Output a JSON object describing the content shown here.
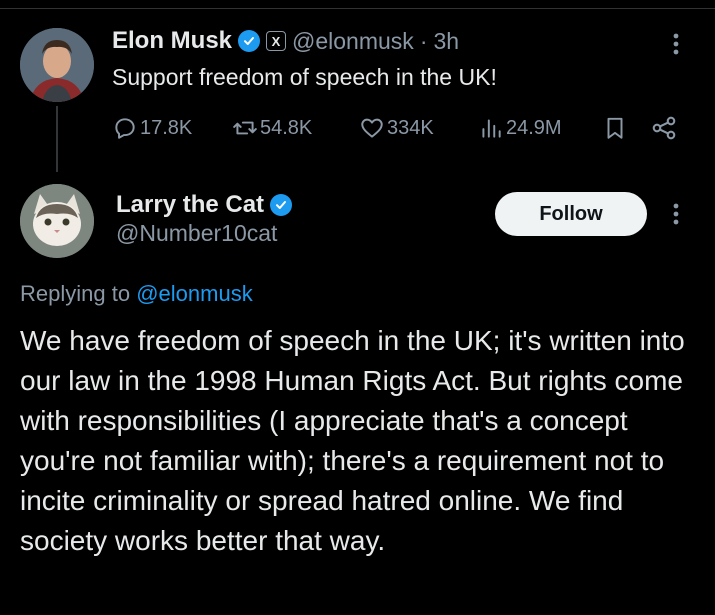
{
  "parent_tweet": {
    "display_name": "Elon Musk",
    "handle": "@elonmusk",
    "separator": "·",
    "time": "3h",
    "text": "Support freedom of speech in the UK!",
    "affiliate_badge": "X",
    "avatar_icon": "elon-musk-avatar",
    "stats": {
      "replies": "17.8K",
      "reposts": "54.8K",
      "likes": "334K",
      "views": "24.9M"
    }
  },
  "reply_tweet": {
    "display_name": "Larry the Cat",
    "handle": "@Number10cat",
    "follow_label": "Follow",
    "replying_prefix": "Replying to",
    "replying_handle": "@elonmusk",
    "text": "We have freedom of speech in the UK; it's written into our law in the 1998 Human Rigts Act. But rights come with responsibilities (I appreciate that's a concept you're not familiar with); there's a requirement not to incite criminality or spread hatred online. We find society works better that way.",
    "avatar_icon": "cat-avatar"
  },
  "colors": {
    "background": "#000000",
    "text_primary": "#e7e9ea",
    "text_secondary": "#8b98a5",
    "accent_blue": "#1d9bf0",
    "follow_button_bg": "#eff3f4",
    "follow_button_text": "#0f1419",
    "divider": "#2f3336"
  }
}
